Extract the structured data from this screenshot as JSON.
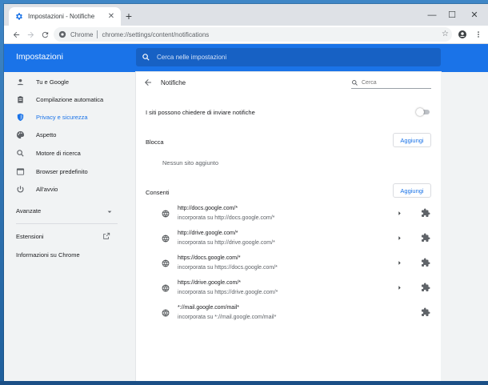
{
  "tab": {
    "title": "Impostazioni - Notifiche",
    "close": "✕"
  },
  "new_tab": "+",
  "window_controls": {
    "minimize": "—",
    "maximize": "☐",
    "close": "✕"
  },
  "omnibox": {
    "site_label": "Chrome",
    "url": "chrome://settings/content/notifications",
    "star": "☆"
  },
  "header": {
    "title": "Impostazioni",
    "search_placeholder": "Cerca nelle impostazioni"
  },
  "sidebar": {
    "items": [
      {
        "label": "Tu e Google",
        "icon": "person-icon",
        "active": false
      },
      {
        "label": "Compilazione automatica",
        "icon": "clipboard-icon",
        "active": false
      },
      {
        "label": "Privacy e sicurezza",
        "icon": "shield-icon",
        "active": true
      },
      {
        "label": "Aspetto",
        "icon": "palette-icon",
        "active": false
      },
      {
        "label": "Motore di ricerca",
        "icon": "search-icon",
        "active": false
      },
      {
        "label": "Browser predefinito",
        "icon": "browser-icon",
        "active": false
      },
      {
        "label": "All'avvio",
        "icon": "power-icon",
        "active": false
      }
    ],
    "advanced": "Avanzate",
    "extensions": "Estensioni",
    "about": "Informazioni su Chrome"
  },
  "page": {
    "title": "Notifiche",
    "search_placeholder": "Cerca",
    "ask_toggle_label": "I siti possono chiedere di inviare notifiche",
    "ask_toggle_on": false,
    "block_label": "Blocca",
    "block_add": "Aggiungi",
    "block_empty": "Nessun sito aggiunto",
    "allow_label": "Consenti",
    "allow_add": "Aggiungi",
    "allowed_sites": [
      {
        "origin": "http://docs.google.com/*",
        "embedded": "incorporata su http://docs.google.com/*",
        "has_chevron": true
      },
      {
        "origin": "http://drive.google.com/*",
        "embedded": "incorporata su http://drive.google.com/*",
        "has_chevron": true
      },
      {
        "origin": "https://docs.google.com/*",
        "embedded": "incorporata su https://docs.google.com/*",
        "has_chevron": true
      },
      {
        "origin": "https://drive.google.com/*",
        "embedded": "incorporata su https://drive.google.com/*",
        "has_chevron": true
      },
      {
        "origin": "*://mail.google.com/mail*",
        "embedded": "incorporata su *://mail.google.com/mail*",
        "has_chevron": false
      }
    ]
  },
  "colors": {
    "accent": "#1a73e8",
    "header": "#1a73e8",
    "background": "#f1f3f4"
  }
}
